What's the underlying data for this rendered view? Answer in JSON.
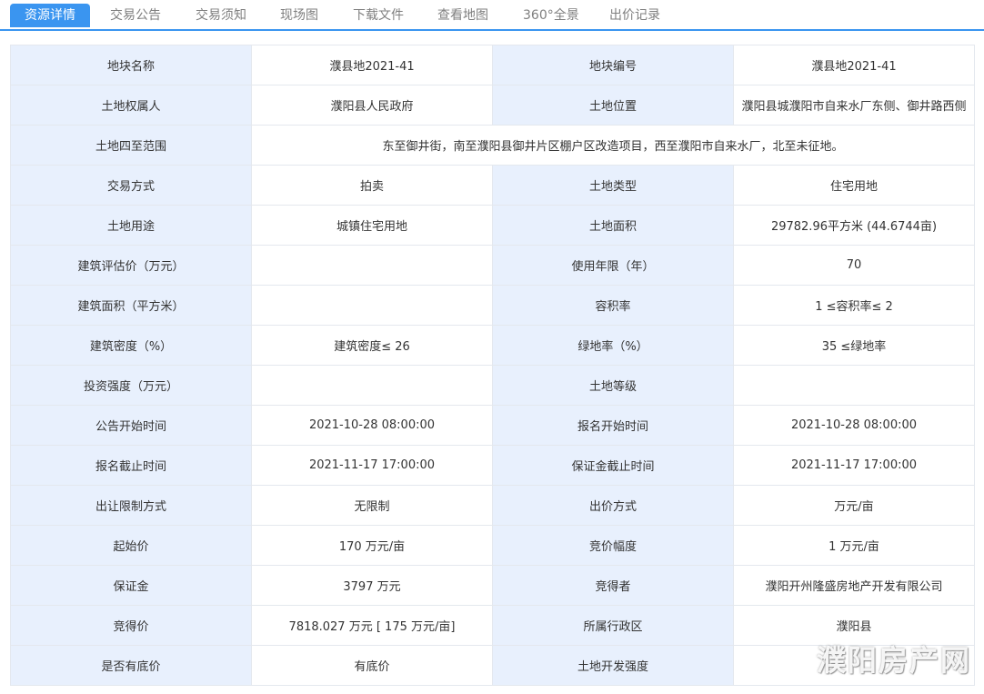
{
  "tabs": [
    {
      "label": "资源详情",
      "active": true
    },
    {
      "label": "交易公告",
      "active": false
    },
    {
      "label": "交易须知",
      "active": false
    },
    {
      "label": "现场图",
      "active": false
    },
    {
      "label": "下载文件",
      "active": false
    },
    {
      "label": "查看地图",
      "active": false
    },
    {
      "label": "360°全景",
      "active": false
    },
    {
      "label": "出价记录",
      "active": false
    }
  ],
  "colors": {
    "accent": "#3a95f0",
    "label_bg": "#e8f0fd",
    "border": "#e4e8ee"
  },
  "table": {
    "rows": [
      [
        [
          "地块名称",
          "濮县地2021-41"
        ],
        [
          "地块编号",
          "濮县地2021-41"
        ]
      ],
      [
        [
          "土地权属人",
          "濮阳县人民政府"
        ],
        [
          "土地位置",
          "濮阳县城濮阳市自来水厂东侧、御井路西侧"
        ]
      ],
      [
        [
          "土地四至范围",
          "东至御井街，南至濮阳县御井片区棚户区改造项目，西至濮阳市自来水厂，北至未征地。"
        ]
      ],
      [
        [
          "交易方式",
          "拍卖"
        ],
        [
          "土地类型",
          "住宅用地"
        ]
      ],
      [
        [
          "土地用途",
          "城镇住宅用地"
        ],
        [
          "土地面积",
          "29782.96平方米 (44.6744亩)"
        ]
      ],
      [
        [
          "建筑评估价（万元）",
          ""
        ],
        [
          "使用年限（年）",
          "70"
        ]
      ],
      [
        [
          "建筑面积（平方米）",
          ""
        ],
        [
          "容积率",
          "1 ≤容积率≤ 2"
        ]
      ],
      [
        [
          "建筑密度（%）",
          "建筑密度≤ 26"
        ],
        [
          "绿地率（%）",
          "35 ≤绿地率"
        ]
      ],
      [
        [
          "投资强度（万元）",
          ""
        ],
        [
          "土地等级",
          ""
        ]
      ],
      [
        [
          "公告开始时间",
          "2021-10-28 08:00:00"
        ],
        [
          "报名开始时间",
          "2021-10-28 08:00:00"
        ]
      ],
      [
        [
          "报名截止时间",
          "2021-11-17 17:00:00"
        ],
        [
          "保证金截止时间",
          "2021-11-17 17:00:00"
        ]
      ],
      [
        [
          "出让限制方式",
          "无限制"
        ],
        [
          "出价方式",
          "万元/亩"
        ]
      ],
      [
        [
          "起始价",
          "170 万元/亩"
        ],
        [
          "竞价幅度",
          "1 万元/亩"
        ]
      ],
      [
        [
          "保证金",
          "3797 万元"
        ],
        [
          "竞得者",
          "濮阳开州隆盛房地产开发有限公司"
        ]
      ],
      [
        [
          "竞得价",
          "7818.027 万元 [ 175 万元/亩]"
        ],
        [
          "所属行政区",
          "濮阳县"
        ]
      ],
      [
        [
          "是否有底价",
          "有底价"
        ],
        [
          "土地开发强度",
          ""
        ]
      ]
    ]
  },
  "watermark": "濮阳房产网"
}
